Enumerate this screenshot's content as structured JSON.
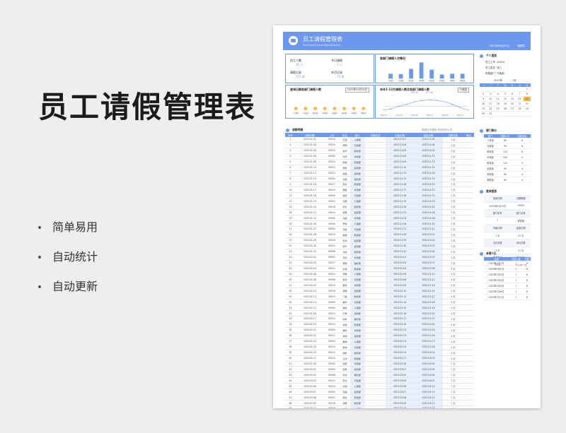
{
  "promo": {
    "title": "员工请假管理表",
    "features": [
      "简单易用",
      "自动统计",
      "自动更新"
    ]
  },
  "header": {
    "title": "员工请假管理表",
    "subtitle": "Employee Leave Management",
    "date_label": "2023年06月01日",
    "user_label": "管理员"
  },
  "kpis": [
    {
      "label": "员工人数",
      "value": "36 人"
    },
    {
      "label": "今日请假",
      "value": "7 人"
    },
    {
      "label": "请假记录",
      "value": "153 条"
    },
    {
      "label": "本月记录",
      "value": "75 条"
    }
  ],
  "dept_chart": {
    "title": "各部门请假人次情况",
    "categories": [
      "人事部",
      "行政部",
      "财务部",
      "市场部",
      "研发部",
      "运营部",
      "采购部",
      "销售部"
    ],
    "values": [
      60,
      55,
      120,
      200,
      110,
      50,
      60,
      60
    ],
    "ymax": 200
  },
  "today_chart": {
    "title": "查询日期各部门请假人数",
    "date": "2023年01月15日",
    "categories": [
      "人事部",
      "行政部",
      "财务部",
      "市场部",
      "研发部",
      "运营部",
      "采购部",
      "销售部"
    ]
  },
  "trend_chart": {
    "title": "本年1-12月请假人数及各部门请假人数",
    "selector": "行政部",
    "legend": [
      "请假人数",
      "部门人数"
    ],
    "months": [
      "2023-01",
      "2023-02",
      "2023-03",
      "2023-04",
      "2023-05",
      "2023-06",
      "2023-07",
      "2023-08",
      "2023-09",
      "2023-10",
      "2023-11",
      "2023-12"
    ],
    "series_a": [
      0.4,
      0.6,
      1.0,
      1.3,
      1.7,
      1.9,
      2.0,
      1.9,
      1.7,
      1.3,
      0.8,
      0.4
    ],
    "series_b": [
      1,
      1,
      1,
      1,
      1,
      1,
      1,
      1,
      1,
      1,
      1,
      1
    ],
    "ymax": 3
  },
  "right_info": {
    "title": "个人信息",
    "rows": [
      [
        "员工工号",
        "00010"
      ],
      [
        "员工姓名",
        "张三"
      ],
      [
        "所属部门",
        "行政部"
      ]
    ]
  },
  "calendar": {
    "year": "2023年",
    "month": "1月",
    "weekdays": [
      "一",
      "二",
      "三",
      "四",
      "五",
      "六",
      "日"
    ],
    "days": [
      "",
      "",
      "",
      "",
      "",
      "",
      "1",
      "2",
      "3",
      "4",
      "5",
      "6",
      "7",
      "8",
      "9",
      "10",
      "11",
      "12",
      "13",
      "14",
      "15",
      "16",
      "17",
      "18",
      "19",
      "20",
      "21",
      "22",
      "23",
      "24",
      "25",
      "26",
      "27",
      "28",
      "29",
      "30",
      "31",
      "",
      "",
      "",
      "",
      ""
    ]
  },
  "leave_table": {
    "title": "请假明细",
    "note": "数据自动更新 请勿修改公式",
    "columns": [
      "序号",
      "请假日期",
      "工号",
      "姓名",
      "部门",
      "请假事由",
      "开始日期",
      "结束日期",
      "请假天数",
      "备注"
    ],
    "rows": [
      [
        "1",
        "2023-01-01",
        "00010",
        "王强",
        "人事部",
        "",
        "2023-01-01",
        "2023-01-04",
        "1 天",
        ""
      ],
      [
        "2",
        "2023-01-04",
        "00010",
        "李明",
        "行政部",
        "",
        "2023-01-04",
        "2023-01-08",
        "1 天",
        ""
      ],
      [
        "3",
        "2023-01-05",
        "00011",
        "张华",
        "财务部",
        "",
        "2023-01-05",
        "2023-01-09",
        "3 天",
        ""
      ],
      [
        "4",
        "2023-01-09",
        "00005",
        "刘洋",
        "市场部",
        "",
        "2023-01-09",
        "2023-01-13",
        "1 天",
        ""
      ],
      [
        "5",
        "2023-01-09",
        "00013",
        "陈静",
        "研发部",
        "",
        "2023-01-09",
        "2023-01-13",
        "1 天",
        ""
      ],
      [
        "6",
        "2023-01-10",
        "00011",
        "杨帆",
        "运营部",
        "",
        "2023-01-10",
        "2023-01-14",
        "1 天",
        ""
      ],
      [
        "7",
        "2023-01-12",
        "00013",
        "赵磊",
        "采购部",
        "",
        "2023-01-12",
        "2023-01-16",
        "2 天",
        ""
      ],
      [
        "8",
        "2023-01-15",
        "00004",
        "孙丽",
        "销售部",
        "",
        "2023-01-15",
        "2023-01-19",
        "1 天",
        ""
      ],
      [
        "9",
        "2023-01-16",
        "00017",
        "周杰",
        "研发部",
        "",
        "2023-01-16",
        "2023-01-20",
        "1 天",
        ""
      ],
      [
        "10",
        "2023-01-17",
        "00019",
        "吴敏",
        "市场部",
        "",
        "2023-01-17",
        "2023-01-21",
        "1 天",
        ""
      ],
      [
        "11",
        "2023-01-18",
        "00020",
        "郑伟",
        "行政部",
        "",
        "2023-01-18",
        "2023-01-22",
        "2 天",
        ""
      ],
      [
        "12",
        "2023-01-19",
        "00021",
        "冯霞",
        "人事部",
        "",
        "2023-01-19",
        "2023-01-23",
        "1 天",
        ""
      ],
      [
        "13",
        "2023-01-20",
        "00018",
        "何平",
        "财务部",
        "",
        "2023-01-20",
        "2023-01-24",
        "1 天",
        ""
      ],
      [
        "14",
        "2023-01-22",
        "00014",
        "韩雪",
        "运营部",
        "",
        "2023-01-22",
        "2023-01-26",
        "1 天",
        ""
      ],
      [
        "15",
        "2023-01-24",
        "00005",
        "马超",
        "市场部",
        "",
        "2023-01-24",
        "2023-01-28",
        "1 天",
        ""
      ],
      [
        "16",
        "2023-01-26",
        "00020",
        "罗娟",
        "人事部",
        "",
        "2023-01-26",
        "2023-01-30",
        "1 天",
        ""
      ],
      [
        "17",
        "2023-01-27",
        "00004",
        "高峰",
        "行政部",
        "",
        "2023-01-27",
        "2023-01-31",
        "2 天",
        ""
      ],
      [
        "18",
        "2023-01-28",
        "00013",
        "梁静",
        "研发部",
        "",
        "2023-01-28",
        "2023-02-01",
        "1 天",
        ""
      ],
      [
        "19",
        "2023-01-29",
        "00016",
        "宋涛",
        "运营部",
        "",
        "2023-01-29",
        "2023-02-02",
        "1 天",
        ""
      ],
      [
        "20",
        "2023-01-30",
        "00011",
        "唐宁",
        "采购部",
        "",
        "2023-01-30",
        "2023-02-03",
        "1 天",
        ""
      ],
      [
        "21",
        "2023-01-31",
        "00006",
        "许晨",
        "财务部",
        "",
        "2023-01-31",
        "2023-02-04",
        "2 天",
        ""
      ],
      [
        "22",
        "2023-02-01",
        "00001",
        "邓杰",
        "市场部",
        "",
        "2023-02-01",
        "2023-02-05",
        "1 天",
        ""
      ],
      [
        "23",
        "2023-02-03",
        "00017",
        "曹颖",
        "销售部",
        "",
        "2023-02-03",
        "2023-02-07",
        "1 天",
        ""
      ],
      [
        "24",
        "2023-02-04",
        "00011",
        "彭博",
        "研发部",
        "",
        "2023-02-04",
        "2023-02-08",
        "3 天",
        ""
      ],
      [
        "25",
        "2023-02-06",
        "00014",
        "曾琳",
        "人事部",
        "",
        "2023-02-06",
        "2023-02-10",
        "1 天",
        ""
      ],
      [
        "26",
        "2023-02-08",
        "00006",
        "蒋涛",
        "行政部",
        "",
        "2023-02-08",
        "2023-02-12",
        "1 天",
        ""
      ],
      [
        "27",
        "2023-02-09",
        "00010",
        "蔡勇",
        "市场部",
        "",
        "2023-02-09",
        "2023-02-13",
        "1 天",
        ""
      ],
      [
        "28",
        "2023-02-10",
        "00018",
        "贾敏",
        "运营部",
        "",
        "2023-02-10",
        "2023-02-14",
        "2 天",
        ""
      ],
      [
        "29",
        "2023-02-13",
        "00013",
        "丁磊",
        "财务部",
        "",
        "2023-02-13",
        "2023-02-17",
        "1 天",
        ""
      ],
      [
        "30",
        "2023-02-14",
        "00009",
        "魏华",
        "行政部",
        "",
        "2023-02-14",
        "2023-02-18",
        "1 天",
        ""
      ],
      [
        "31",
        "2023-02-15",
        "00004",
        "薛峰",
        "人事部",
        "",
        "2023-02-15",
        "2023-02-19",
        "1 天",
        ""
      ],
      [
        "32",
        "2023-02-16",
        "00014",
        "叶青",
        "采购部",
        "",
        "2023-02-16",
        "2023-02-20",
        "1 天",
        ""
      ],
      [
        "33",
        "2023-02-17",
        "00012",
        "阎军",
        "销售部",
        "",
        "2023-02-17",
        "2023-02-21",
        "2 天",
        ""
      ],
      [
        "34",
        "2023-02-20",
        "00013",
        "余丽",
        "研发部",
        "",
        "2023-02-20",
        "2023-02-24",
        "1 天",
        ""
      ],
      [
        "35",
        "2023-02-21",
        "00004",
        "潘伟",
        "市场部",
        "",
        "2023-02-21",
        "2023-02-25",
        "1 天",
        ""
      ],
      [
        "36",
        "2023-02-22",
        "00017",
        "杜明",
        "运营部",
        "",
        "2023-02-22",
        "2023-02-26",
        "1 天",
        ""
      ],
      [
        "37",
        "2023-02-23",
        "00003",
        "戴静",
        "人事部",
        "",
        "2023-02-23",
        "2023-02-27",
        "1 天",
        ""
      ],
      [
        "38",
        "2023-02-24",
        "00014",
        "夏林",
        "行政部",
        "",
        "2023-02-24",
        "2023-02-28",
        "2 天",
        ""
      ],
      [
        "39",
        "2023-02-25",
        "00012",
        "钟鸣",
        "财务部",
        "",
        "2023-02-25",
        "2023-03-01",
        "1 天",
        ""
      ],
      [
        "40",
        "2023-02-27",
        "00010",
        "汪洋",
        "研发部",
        "",
        "2023-02-27",
        "2023-03-03",
        "1 天",
        ""
      ],
      [
        "41",
        "2023-02-28",
        "00005",
        "田野",
        "市场部",
        "",
        "2023-02-28",
        "2023-03-04",
        "1 天",
        ""
      ],
      [
        "42",
        "2023-03-01",
        "00003",
        "任重",
        "采购部",
        "",
        "2023-03-01",
        "2023-03-05",
        "1 天",
        ""
      ],
      [
        "43",
        "2023-03-02",
        "00008",
        "姜涛",
        "销售部",
        "",
        "2023-03-02",
        "2023-03-06",
        "1 天",
        ""
      ],
      [
        "44",
        "2023-03-03",
        "00011",
        "范冰",
        "行政部",
        "",
        "2023-03-03",
        "2023-03-07",
        "2 天",
        ""
      ],
      [
        "45",
        "2023-03-06",
        "00014",
        "方圆",
        "人事部",
        "",
        "2023-03-06",
        "2023-03-10",
        "1 天",
        ""
      ],
      [
        "46",
        "2023-03-07",
        "00002",
        "石磊",
        "运营部",
        "",
        "2023-03-07",
        "2023-03-11",
        "1 天",
        ""
      ],
      [
        "47",
        "2023-03-08",
        "00007",
        "姚远",
        "研发部",
        "",
        "2023-03-08",
        "2023-03-12",
        "1 天",
        ""
      ],
      [
        "48",
        "2023-03-09",
        "00018",
        "谭笑",
        "财务部",
        "",
        "2023-03-09",
        "2023-03-13",
        "1 天",
        ""
      ],
      [
        "49",
        "2023-03-10",
        "00016",
        "廖凯",
        "市场部",
        "",
        "2023-03-10",
        "2023-03-14",
        "1 天",
        ""
      ],
      [
        "50",
        "2023-03-13",
        "00003",
        "邹丽",
        "行政部",
        "",
        "2023-03-13",
        "2023-03-17",
        "2 天",
        ""
      ],
      [
        "51",
        "2023-03-14",
        "00014",
        "熊伟",
        "采购部",
        "",
        "2023-03-14",
        "2023-03-18",
        "1 天",
        ""
      ],
      [
        "52",
        "2023-03-15",
        "00009",
        "金鑫",
        "销售部",
        "",
        "2023-03-15",
        "2023-03-19",
        "1 天",
        ""
      ],
      [
        "53",
        "2023-03-16",
        "00011",
        "陆遥",
        "人事部",
        "",
        "2023-03-16",
        "2023-03-20",
        "1 天",
        ""
      ]
    ]
  },
  "dept_table": {
    "title": "部门统计",
    "columns": [
      "部门",
      "请假人次",
      "请假天数"
    ],
    "rows": [
      [
        "人事部",
        "60",
        "6"
      ],
      [
        "行政部",
        "55",
        "6"
      ],
      [
        "财务部",
        "120",
        "6"
      ],
      [
        "市场部",
        "200",
        "5"
      ],
      [
        "研发部",
        "110",
        "5"
      ],
      [
        "运营部",
        "50",
        "4"
      ],
      [
        "采购部",
        "60",
        "4"
      ],
      [
        "销售部",
        "60",
        "4"
      ]
    ]
  },
  "query": {
    "title": "查询信息",
    "rows": [
      [
        "查询日期",
        "日期明细"
      ],
      [
        "2023年1月15日",
        "13000"
      ],
      [
        "部门序号",
        "部门名称"
      ],
      [
        "7",
        "采购部"
      ],
      [
        "开始日期",
        "结束日期"
      ],
      [
        "1 天",
        "31 天"
      ],
      [
        "当月天数",
        "本月天数"
      ],
      [
        "1 天",
        "21 天"
      ],
      [
        "查询部门",
        "查询月份"
      ],
      [
        "2023",
        "2023年1月"
      ]
    ]
  },
  "daily_table": {
    "title": "本周7日",
    "columns": [
      "日期",
      "请假人数",
      "天数"
    ],
    "rows": [
      [
        "2023年1月1日",
        "1",
        "6"
      ],
      [
        "2023年1月2日",
        "1",
        "6"
      ],
      [
        "2023年1月3日",
        "1",
        "6"
      ],
      [
        "2023年1月4日",
        "1",
        "6"
      ],
      [
        "2023年1月5日",
        "1",
        "6"
      ],
      [
        "2023年1月6日",
        "1",
        "6"
      ],
      [
        "2023年1月7日",
        "1",
        "6"
      ]
    ]
  }
}
